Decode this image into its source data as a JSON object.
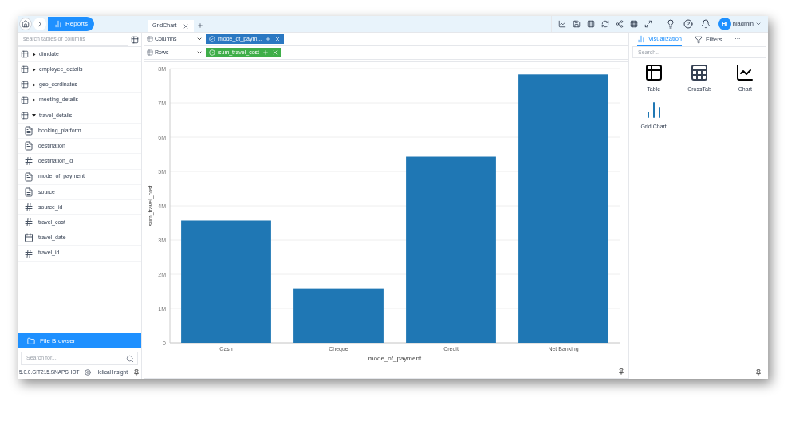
{
  "nav": {
    "section": "Reports"
  },
  "sidebar": {
    "search_placeholder": "search tables or columns",
    "tables": [
      {
        "name": "dimdate",
        "expanded": false
      },
      {
        "name": "employee_details",
        "expanded": false
      },
      {
        "name": "geo_cordinates",
        "expanded": false
      },
      {
        "name": "meeting_details",
        "expanded": false
      },
      {
        "name": "travel_details",
        "expanded": true,
        "children": [
          {
            "name": "booking_platform",
            "kind": "text"
          },
          {
            "name": "destination",
            "kind": "text"
          },
          {
            "name": "destination_id",
            "kind": "number"
          },
          {
            "name": "mode_of_payment",
            "kind": "text"
          },
          {
            "name": "source",
            "kind": "text"
          },
          {
            "name": "source_id",
            "kind": "number"
          },
          {
            "name": "travel_cost",
            "kind": "number"
          },
          {
            "name": "travel_date",
            "kind": "date"
          },
          {
            "name": "travel_id",
            "kind": "number"
          }
        ]
      }
    ],
    "file_browser": "File Browser",
    "file_search_placeholder": "Search for...",
    "version": "5.0.0.GIT215.SNAPSHOT",
    "brand": "Helical Insight"
  },
  "tabs": [
    {
      "label": "GridChart",
      "selected": true
    }
  ],
  "user": {
    "initials": "HI",
    "name": "hiadmin"
  },
  "shelves": [
    {
      "label": "Columns",
      "pill": "mode_of_paym...",
      "color": "#2b78c2"
    },
    {
      "label": "Rows",
      "pill": "sum_travel_cost",
      "color": "#3fae49"
    }
  ],
  "chart": {
    "chart_data": {
      "type": "bar",
      "xlabel": "mode_of_payment",
      "ylabel": "sum_travel_cost",
      "grid": true,
      "categories": [
        "Cash",
        "Cheque",
        "Credit",
        "Net Banking"
      ],
      "series": [
        {
          "color": "#1f77b4",
          "values": [
            3570000,
            1590000,
            5430000,
            7830000
          ]
        }
      ],
      "ylim": [
        0,
        8000000
      ],
      "yticks": [
        {
          "value": 0,
          "label": "0"
        },
        {
          "value": 1000000,
          "label": "1M"
        },
        {
          "value": 2000000,
          "label": "2M"
        },
        {
          "value": 3000000,
          "label": "3M"
        },
        {
          "value": 4000000,
          "label": "4M"
        },
        {
          "value": 5000000,
          "label": "5M"
        },
        {
          "value": 6000000,
          "label": "6M"
        },
        {
          "value": 7000000,
          "label": "7M"
        },
        {
          "value": 8000000,
          "label": "8M"
        }
      ]
    }
  },
  "panel": {
    "tabs": [
      {
        "label": "Visualization",
        "selected": true
      },
      {
        "label": "Filters",
        "selected": false
      }
    ],
    "more": "···",
    "search_placeholder": "Search..",
    "items": [
      {
        "label": "Table",
        "kind": "table"
      },
      {
        "label": "CrossTab",
        "kind": "crosstab"
      },
      {
        "label": "Chart",
        "kind": "chart"
      },
      {
        "label": "Grid Chart",
        "kind": "grid"
      }
    ]
  }
}
